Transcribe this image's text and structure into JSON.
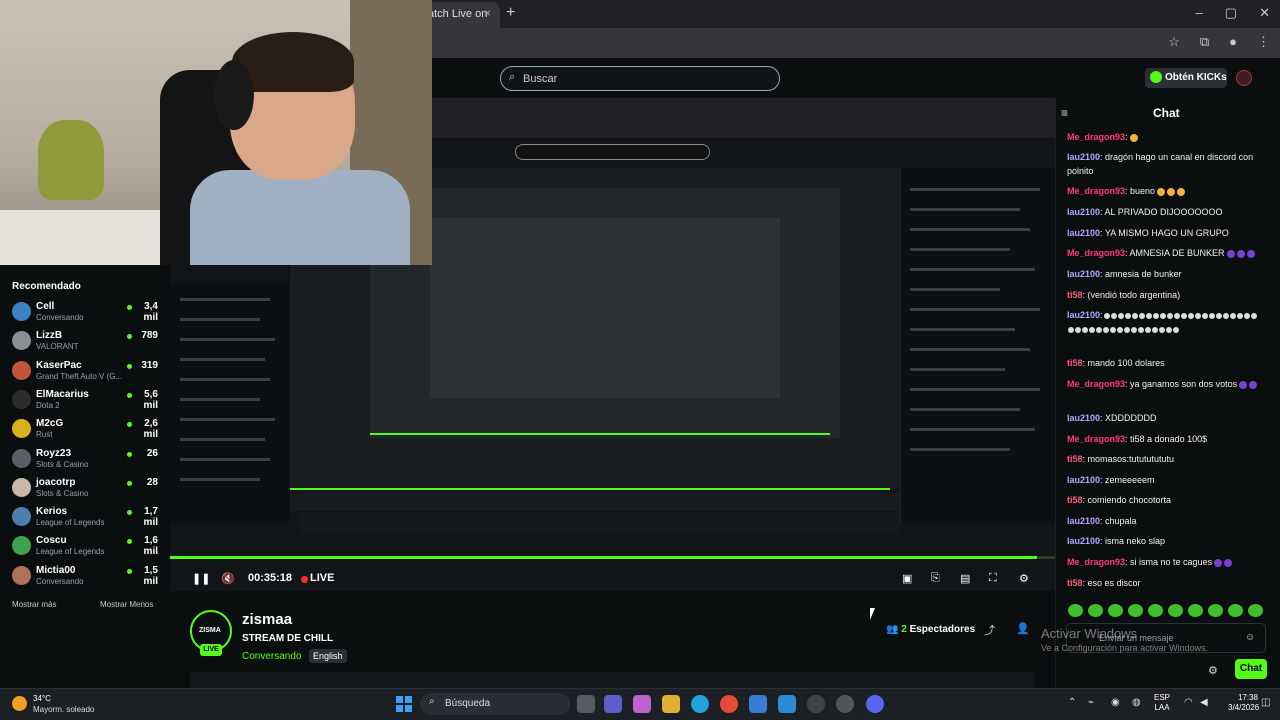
{
  "browser": {
    "tab_title": "atch Live on",
    "tab_close": "×",
    "new_tab": "+",
    "window_controls": [
      "–",
      "▢",
      "✕"
    ]
  },
  "header": {
    "search_placeholder": "Buscar",
    "get_kicks_label": "Obtén KICKs"
  },
  "sidebar": {
    "title": "Recomendado",
    "channels": [
      {
        "name": "Cell",
        "category": "Conversando",
        "viewers": "3,4 mil",
        "color": "#3b82c4"
      },
      {
        "name": "LizzB",
        "category": "VALORANT",
        "viewers": "789",
        "color": "#8a8f95"
      },
      {
        "name": "KaserPac",
        "category": "Grand Theft Auto V (G...",
        "viewers": "319",
        "color": "#c0553a"
      },
      {
        "name": "ElMacarius",
        "category": "Dota 2",
        "viewers": "5,6 mil",
        "color": "#2d2d2d"
      },
      {
        "name": "M2cG",
        "category": "Rust",
        "viewers": "2,6 mil",
        "color": "#d8b21b"
      },
      {
        "name": "Royz23",
        "category": "Slots & Casino",
        "viewers": "26",
        "color": "#5a5f66"
      },
      {
        "name": "joacotrp",
        "category": "Slots & Casino",
        "viewers": "28",
        "color": "#c9b7a7"
      },
      {
        "name": "Kerios",
        "category": "League of Legends",
        "viewers": "1,7 mil",
        "color": "#4a7fb0"
      },
      {
        "name": "Coscu",
        "category": "League of Legends",
        "viewers": "1,6 mil",
        "color": "#3fa34d"
      },
      {
        "name": "Mictia00",
        "category": "Conversando",
        "viewers": "1,5 mil",
        "color": "#b0705a"
      }
    ],
    "show_more": "Mostrar más",
    "show_less": "Mostrar Menos"
  },
  "player": {
    "play_icon": "❚❚",
    "mute_icon": "🔇",
    "time": "00:35:18",
    "live_label": "LIVE",
    "progress": 0.98
  },
  "stream": {
    "avatar_text": "ZISMA",
    "live_badge": "LIVE",
    "streamer": "zismaa",
    "title": "STREAM DE CHILL",
    "category": "Conversando",
    "language": "English",
    "viewers_count": "2",
    "viewers_label": "Espectadores"
  },
  "chat": {
    "title": "Chat",
    "messages": [
      {
        "user": "Me_dragon93",
        "cls": "u-dragon",
        "text": ":",
        "emotes": "y"
      },
      {
        "user": "lau2100",
        "cls": "u-lau",
        "text": ": dragón hago un canal en discord con polnito",
        "emotes": ""
      },
      {
        "user": "Me_dragon93",
        "cls": "u-dragon",
        "text": ": bueno",
        "emotes": "yyy"
      },
      {
        "user": "lau2100",
        "cls": "u-lau",
        "text": ": AL PRIVADO DIJOOOOOOO",
        "emotes": ""
      },
      {
        "user": "lau2100",
        "cls": "u-lau",
        "text": ": YA MISMO HAGO UN GRUPO",
        "emotes": ""
      },
      {
        "user": "Me_dragon93",
        "cls": "u-dragon",
        "text": ": AMNESIA DE BUNKER",
        "emotes": "ppp"
      },
      {
        "user": "lau2100",
        "cls": "u-lau",
        "text": ": amnesia de bunker",
        "emotes": ""
      },
      {
        "user": "ti58",
        "cls": "u-ti",
        "text": ": (vendió todo argentina)",
        "emotes": ""
      },
      {
        "user": "lau2100",
        "cls": "u-lau",
        "text": ":",
        "emotes": "wwwwwwwwwwwwwwwwwwwwwwwwwwwwwwwwwwwwww"
      },
      {
        "user": "ti58",
        "cls": "u-ti",
        "text": ": mando 100 dolares",
        "emotes": ""
      },
      {
        "user": "Me_dragon93",
        "cls": "u-dragon",
        "text": ": ya ganamos son dos votos",
        "emotes": "pp"
      },
      {
        "user": "lau2100",
        "cls": "u-lau",
        "text": ": XDDDDDDD",
        "emotes": ""
      },
      {
        "user": "Me_dragon93",
        "cls": "u-dragon",
        "text": ": ti58 a donado 100$",
        "emotes": ""
      },
      {
        "user": "ti58",
        "cls": "u-ti",
        "text": ": momasos:tutututututu",
        "emotes": ""
      },
      {
        "user": "lau2100",
        "cls": "u-lau",
        "text": ": zemeeeeem",
        "emotes": ""
      },
      {
        "user": "ti58",
        "cls": "u-ti",
        "text": ": comiendo chocotorta",
        "emotes": ""
      },
      {
        "user": "lau2100",
        "cls": "u-lau",
        "text": ": chupala",
        "emotes": ""
      },
      {
        "user": "lau2100",
        "cls": "u-lau",
        "text": ": isma neko slap",
        "emotes": ""
      },
      {
        "user": "Me_dragon93",
        "cls": "u-dragon",
        "text": ": si isma no te cagues",
        "emotes": "pp"
      },
      {
        "user": "ti58",
        "cls": "u-ti",
        "text": ": eso es discor",
        "emotes": ""
      }
    ],
    "input_placeholder": "Enviar un mensaje",
    "send_label": "Chat"
  },
  "watermark": {
    "line1": "Activar Windows",
    "line2": "Ve a Configuración para activar Windows."
  },
  "taskbar": {
    "temp": "34°C",
    "weather": "Mayorm. soleado",
    "search_label": "Búsqueda",
    "lang_1": "ESP",
    "lang_2": "LAA",
    "time": "17:38",
    "date": "3/4/2026"
  }
}
